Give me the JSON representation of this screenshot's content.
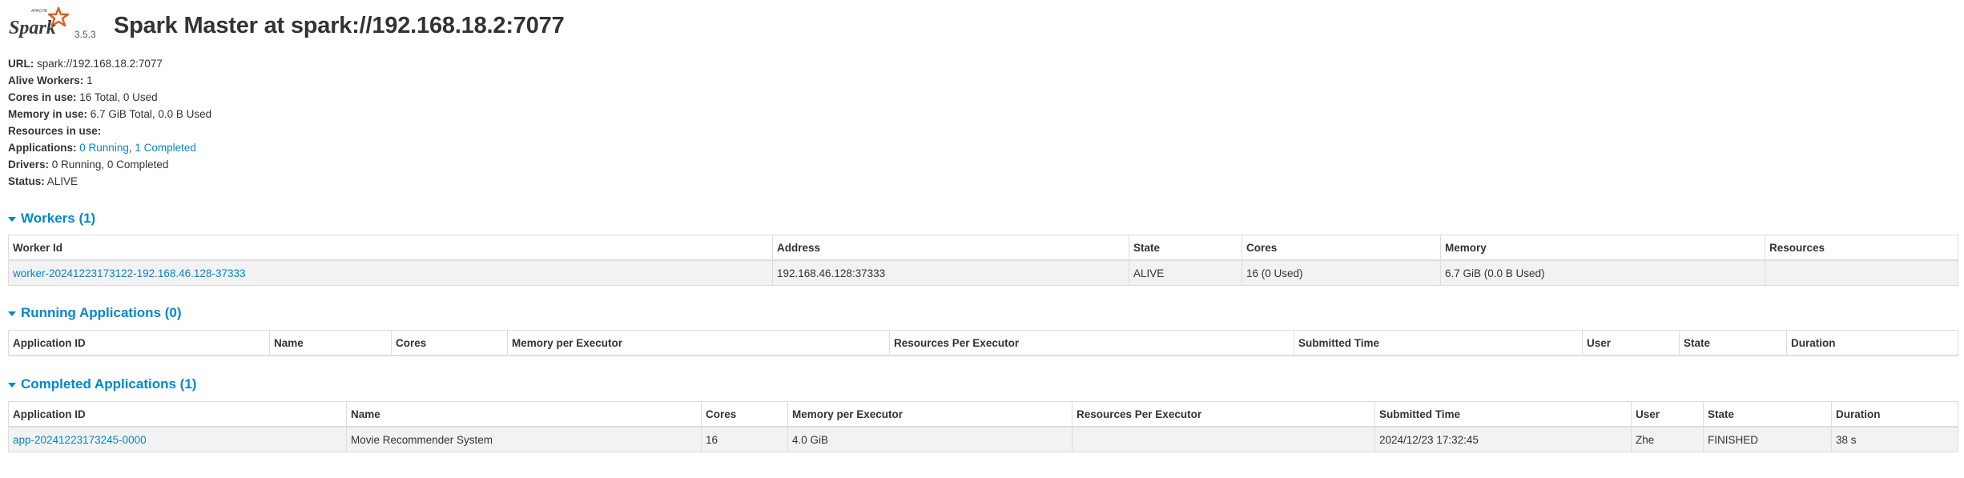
{
  "header": {
    "logo_alt": "Spark",
    "version": "3.5.3",
    "title": "Spark Master at spark://192.168.18.2:7077"
  },
  "summary": {
    "url_label": "URL:",
    "url_value": "spark://192.168.18.2:7077",
    "alive_workers_label": "Alive Workers:",
    "alive_workers_value": "1",
    "cores_label": "Cores in use:",
    "cores_value": "16 Total, 0 Used",
    "memory_label": "Memory in use:",
    "memory_value": "6.7 GiB Total, 0.0 B Used",
    "resources_label": "Resources in use:",
    "applications_label": "Applications:",
    "applications_running": "0 Running",
    "applications_sep": ",",
    "applications_completed": "1 Completed",
    "drivers_label": "Drivers:",
    "drivers_value": "0 Running, 0 Completed",
    "status_label": "Status:",
    "status_value": "ALIVE"
  },
  "workers": {
    "heading": "Workers (1)",
    "columns": [
      "Worker Id",
      "Address",
      "State",
      "Cores",
      "Memory",
      "Resources"
    ],
    "rows": [
      {
        "worker_id": "worker-20241223173122-192.168.46.128-37333",
        "address": "192.168.46.128:37333",
        "state": "ALIVE",
        "cores": "16 (0 Used)",
        "memory": "6.7 GiB (0.0 B Used)",
        "resources": ""
      }
    ]
  },
  "running_apps": {
    "heading": "Running Applications (0)",
    "columns": [
      "Application ID",
      "Name",
      "Cores",
      "Memory per Executor",
      "Resources Per Executor",
      "Submitted Time",
      "User",
      "State",
      "Duration"
    ]
  },
  "completed_apps": {
    "heading": "Completed Applications (1)",
    "columns": [
      "Application ID",
      "Name",
      "Cores",
      "Memory per Executor",
      "Resources Per Executor",
      "Submitted Time",
      "User",
      "State",
      "Duration"
    ],
    "rows": [
      {
        "app_id": "app-20241223173245-0000",
        "name": "Movie Recommender System",
        "cores": "16",
        "memory": "4.0 GiB",
        "resources": "",
        "submitted": "2024/12/23 17:32:45",
        "user": "Zhe",
        "state": "FINISHED",
        "duration": "38 s"
      }
    ]
  },
  "colors": {
    "link": "#0088cc",
    "text": "#333333",
    "row_bg": "#f2f2f2",
    "border": "#dddddd",
    "logo_orange": "#e25a1c"
  },
  "icons": [
    "spark-logo",
    "collapse-arrow-icon"
  ]
}
